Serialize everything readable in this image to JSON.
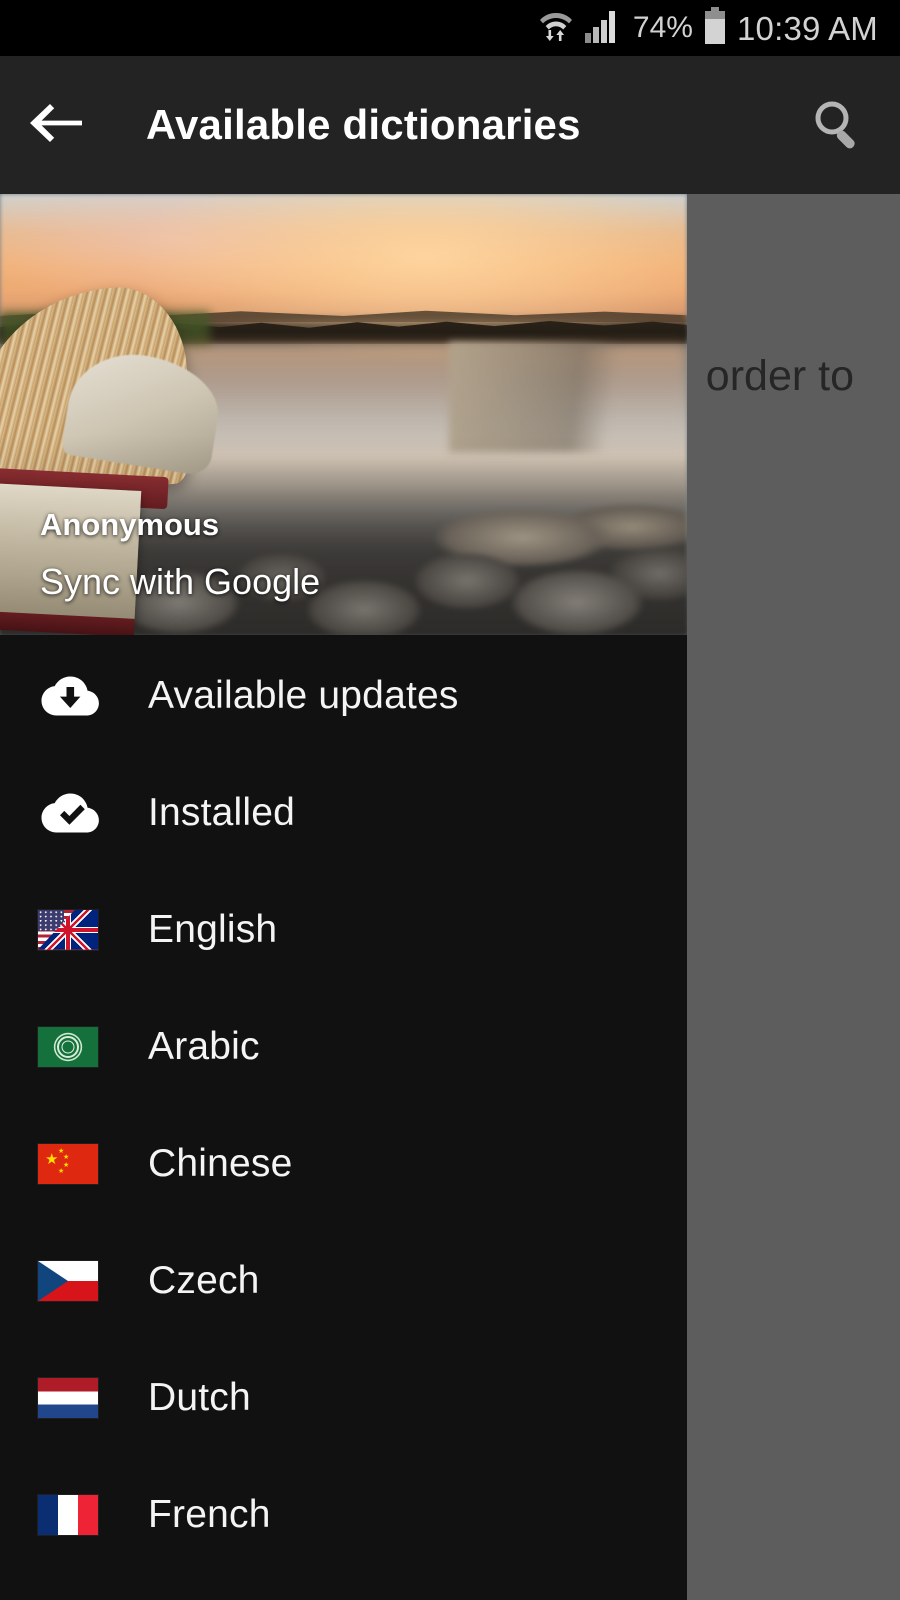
{
  "statusbar": {
    "wifi_icon": "wifi-with-data-arrows-icon",
    "signal_icon": "cellular-signal-icon",
    "battery_percent": "74%",
    "battery_icon": "battery-icon",
    "time": "10:39 AM"
  },
  "toolbar": {
    "back_icon": "back-arrow-icon",
    "title": "Available dictionaries",
    "search_icon": "search-icon"
  },
  "background_content": {
    "visible_text": "order to"
  },
  "drawer": {
    "header": {
      "account_name": "Anonymous",
      "account_action": "Sync with Google",
      "image_description": "open-book-sunset-lake-photo"
    },
    "items": [
      {
        "label": "Available updates",
        "icon": "cloud-download-icon",
        "type": "icon"
      },
      {
        "label": "Installed",
        "icon": "cloud-check-icon",
        "type": "icon"
      },
      {
        "label": "English",
        "icon": "flag-english-icon",
        "type": "flag"
      },
      {
        "label": "Arabic",
        "icon": "flag-arabic-icon",
        "type": "flag"
      },
      {
        "label": "Chinese",
        "icon": "flag-chinese-icon",
        "type": "flag"
      },
      {
        "label": "Czech",
        "icon": "flag-czech-icon",
        "type": "flag"
      },
      {
        "label": "Dutch",
        "icon": "flag-dutch-icon",
        "type": "flag"
      },
      {
        "label": "French",
        "icon": "flag-french-icon",
        "type": "flag"
      }
    ]
  },
  "colors": {
    "status_bar_bg": "#000000",
    "toolbar_bg": "#232323",
    "drawer_bg": "#111111",
    "scrim": "#676767",
    "text_primary": "#ffffff"
  }
}
